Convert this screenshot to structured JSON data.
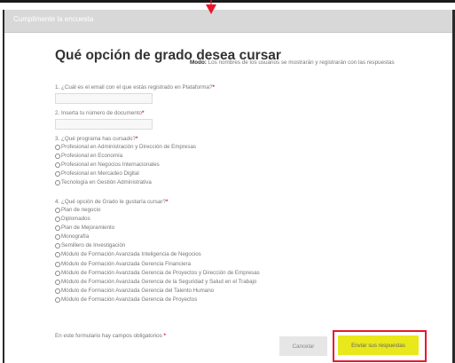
{
  "window": {
    "title": "Cumplimente la encuesta"
  },
  "form": {
    "title": "Qué opción de grado desea cursar",
    "mode_label": "Modo:",
    "mode_text": " Los nombres de los usuarios se mostrarán y registrarán con las respuestas"
  },
  "questions": {
    "q1": {
      "label": "1. ¿Cuál es el email con el que estás registrado en Plataforma?",
      "required_mark": "*",
      "value": ""
    },
    "q2": {
      "label": "2. Inserta tu número de documento",
      "required_mark": "*",
      "value": ""
    },
    "q3": {
      "label": "3. ¿Qué programa has cursado?",
      "required_mark": "*",
      "options": [
        "Profesional en Administración y Dirección de Empresas",
        "Profesional en Economía",
        "Profesional en Negocios Internacionales",
        "Profesional en Mercadeo Digital",
        "Tecnología en Gestión Administrativa"
      ]
    },
    "q4": {
      "label": "4. ¿Qué opción de Grado le gustaría cursar?",
      "required_mark": "*",
      "options": [
        "Plan de negocio",
        "Diplomados",
        "Plan de Mejoramiento",
        "Monografía",
        "Semillero de Investigación",
        "Módulo de Formación Avanzada Inteligencia de Negocios",
        "Módulo de Formación Avanzada Gerencia Financiera",
        "Módulo de Formación Avanzada Gerencia de Proyectos y Dirección de Empresas",
        "Módulo de Formación Avanzada Gerencia de la Seguridad y Salud en el Trabajo",
        "Módulo de Formación Avanzada Gerencia del Talento Humano",
        "Módulo de Formación Avanzada Gerencia de Proyectos"
      ]
    }
  },
  "footer": {
    "required_note": "En este formulario hay campos obligatorios ",
    "required_mark": "*",
    "cancel_label": "Cancelar",
    "submit_label": "Enviar sus respuestas"
  },
  "colors": {
    "required": "#e0203a",
    "submit_button": "#e8e81c",
    "annotation_red": "#e8182c",
    "header_bar": "#d8d8d8"
  }
}
